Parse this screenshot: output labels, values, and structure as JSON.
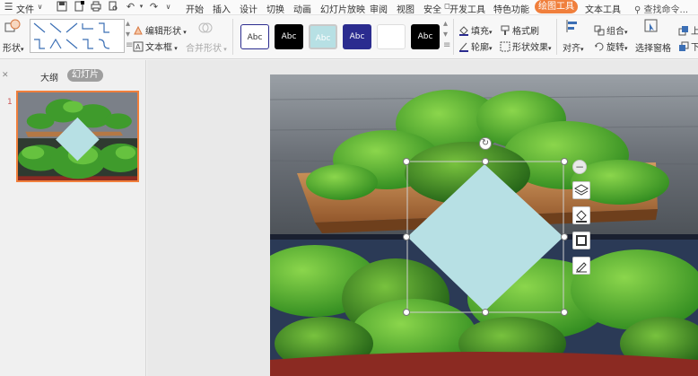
{
  "menubar": {
    "file_menu": "文件",
    "tabs": [
      "开始",
      "插入",
      "设计",
      "切换",
      "动画",
      "幻灯片放映",
      "审阅",
      "视图",
      "安全",
      "开发工具",
      "特色功能",
      "绘图工具",
      "文本工具"
    ],
    "active_tab": "绘图工具",
    "search": "查找命令..."
  },
  "ribbon": {
    "shape_label": "形状",
    "edit_shape": "编辑形状",
    "text_box": "文本框",
    "merge_shape": "合并形状",
    "style_label": "Abc",
    "fill": "填充",
    "format_brush": "格式刷",
    "outline": "轮廓",
    "shape_effects": "形状效果",
    "align": "对齐",
    "group": "组合",
    "rotate": "旋转",
    "select_pane": "选择窗格",
    "bring_up": "上移",
    "send_down": "下移"
  },
  "left_panel": {
    "outline_tab": "大纲",
    "slides_tab": "幻灯片",
    "slide_number": "1"
  },
  "colors": {
    "accent": "#f07f3c",
    "diamond": "#b7e0e4",
    "swatches": [
      "#ffffff",
      "#000000",
      "#b7e0e4",
      "#2b2c8f",
      "#ffffff",
      "#000000"
    ]
  }
}
